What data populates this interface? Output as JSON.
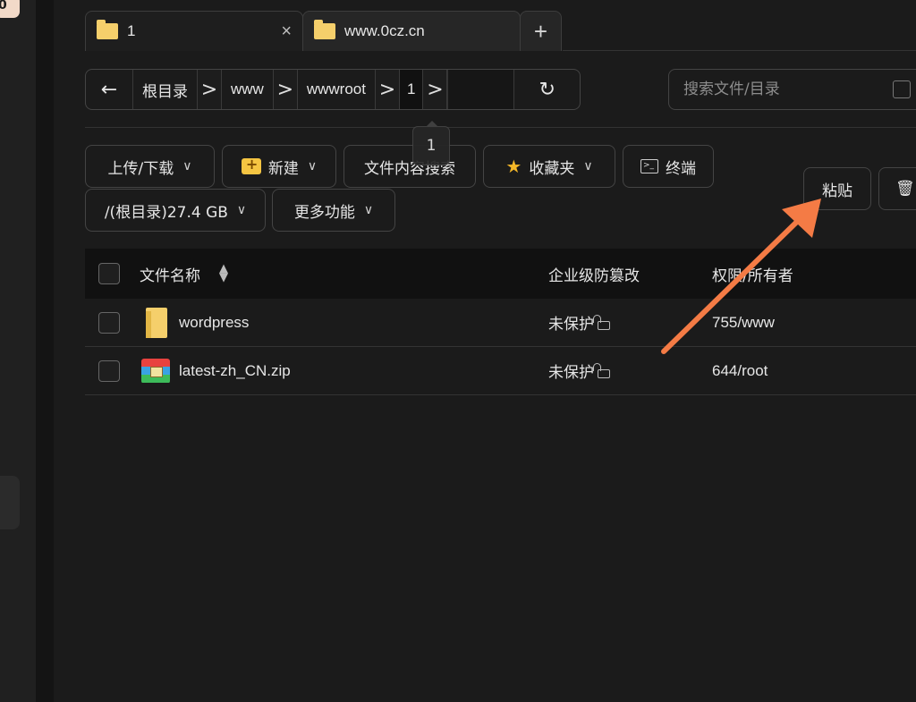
{
  "side_badge": "0",
  "tabs": [
    {
      "label": "1",
      "active": true
    },
    {
      "label": "www.0cz.cn",
      "active": false
    }
  ],
  "tab_add_symbol": "+",
  "tab_close_symbol": "×",
  "breadcrumb": {
    "back_symbol": "←",
    "separator": ">",
    "items": [
      "根目录",
      "www",
      "wwwroot",
      "1"
    ],
    "refresh_symbol": "↻"
  },
  "path_tooltip": "1",
  "search": {
    "placeholder": "搜索文件/目录"
  },
  "toolbar": {
    "upload_download": "上传/下载",
    "new": "新建",
    "content_search": "文件内容搜索",
    "favorites": "收藏夹",
    "terminal": "终端",
    "disk": "/(根目录)27.4 GB",
    "more": "更多功能",
    "paste": "粘贴",
    "dropdown_caret": "∨"
  },
  "table": {
    "headers": {
      "name": "文件名称",
      "protect": "企业级防篡改",
      "perm": "权限/所有者"
    },
    "sort_icon": "sort-icon",
    "rows": [
      {
        "name": "wordpress",
        "type": "folder",
        "protect": "未保护",
        "perm": "755/www"
      },
      {
        "name": "latest-zh_CN.zip",
        "type": "zip",
        "protect": "未保护",
        "perm": "644/root"
      }
    ]
  },
  "annotation": {
    "arrow_color": "#f47b45"
  }
}
